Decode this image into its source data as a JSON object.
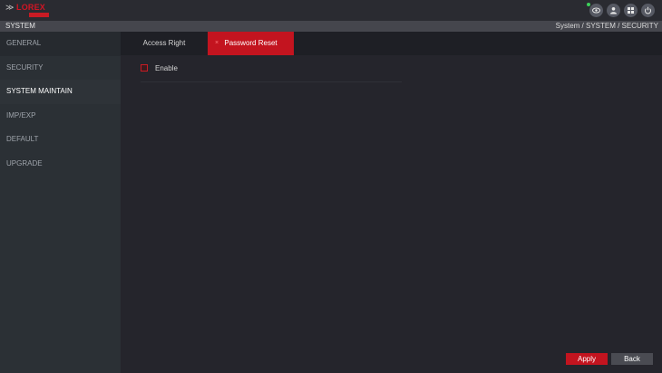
{
  "header": {
    "logo_text": "LOREX",
    "icons": [
      "eye-icon",
      "user-icon",
      "grid-icon",
      "power-icon"
    ],
    "status_color": "#3cd15a"
  },
  "titlebar": {
    "title": "SYSTEM",
    "breadcrumb": "System  /  SYSTEM  /  SECURITY"
  },
  "sidebar": {
    "items": [
      {
        "label": "GENERAL"
      },
      {
        "label": "SECURITY"
      },
      {
        "label": "SYSTEM MAINTAIN"
      },
      {
        "label": "IMP/EXP"
      },
      {
        "label": "DEFAULT"
      },
      {
        "label": "UPGRADE"
      }
    ]
  },
  "tabs": [
    {
      "label": "Access Right"
    },
    {
      "label": "Password Reset"
    }
  ],
  "form": {
    "enable_label": "Enable",
    "enable_checked": false
  },
  "buttons": {
    "apply": "Apply",
    "back": "Back"
  },
  "colors": {
    "accent": "#c3141f",
    "background": "#24242b",
    "sidebar": "#2b3035"
  }
}
